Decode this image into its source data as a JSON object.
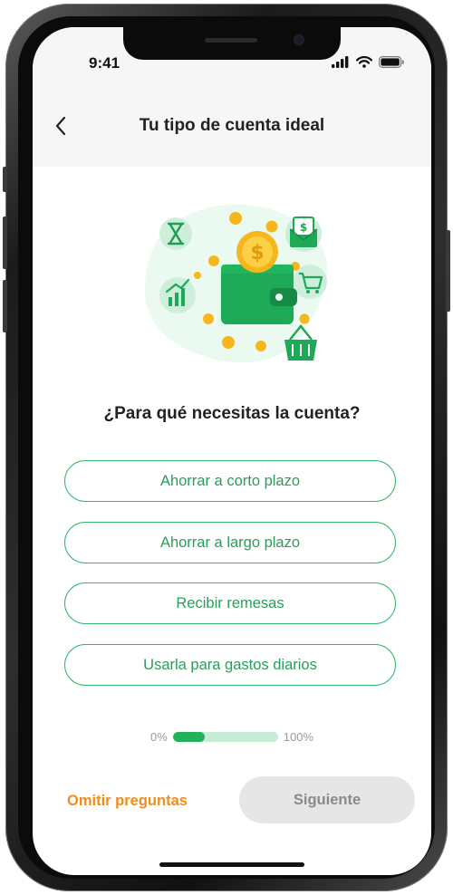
{
  "status_bar": {
    "time": "9:41"
  },
  "header": {
    "title": "Tu tipo de cuenta ideal"
  },
  "question": "¿Para qué necesitas la cuenta?",
  "options": [
    {
      "label": "Ahorrar a corto plazo"
    },
    {
      "label": "Ahorrar a largo plazo"
    },
    {
      "label": "Recibir remesas"
    },
    {
      "label": "Usarla para gastos diarios"
    }
  ],
  "progress": {
    "start_label": "0%",
    "end_label": "100%",
    "value_percent": 30
  },
  "footer": {
    "skip_label": "Omitir preguntas",
    "next_label": "Siguiente"
  },
  "colors": {
    "accent": "#2fb66a",
    "skip": "#ef8d19",
    "disabled_bg": "#e6e6e6",
    "disabled_text": "#8a8a8a"
  }
}
